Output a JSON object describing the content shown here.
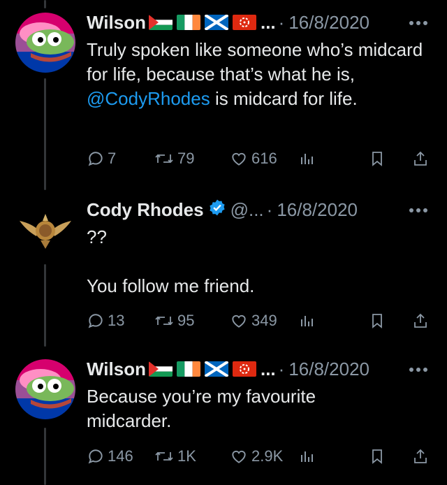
{
  "tweets": [
    {
      "name": "Wilson",
      "flags": [
        "palestine-flag",
        "ireland-flag",
        "scotland-flag",
        "hong-kong-flag"
      ],
      "ellipsis": "...",
      "date": "16/8/2020",
      "text_pre": "Truly spoken like someone who’s midcard for life, because that’s what he is, ",
      "mention": "@CodyRhodes",
      "text_post": " is midcard for life.",
      "replies": "7",
      "reposts": "79",
      "likes": "616"
    },
    {
      "name": "Cody Rhodes",
      "verified": true,
      "handle": "@...",
      "date": "16/8/2020",
      "line1": "??",
      "line2": "You follow me friend.",
      "replies": "13",
      "reposts": "95",
      "likes": "349"
    },
    {
      "name": "Wilson",
      "flags": [
        "palestine-flag",
        "ireland-flag",
        "scotland-flag",
        "hong-kong-flag"
      ],
      "ellipsis": "...",
      "date": "16/8/2020",
      "text": "Because you’re my favourite midcarder.",
      "replies": "146",
      "reposts": "1K",
      "likes": "2.9K"
    }
  ],
  "ui": {
    "dot_separator": "·",
    "accent": "#1d9bf0",
    "secondary": "#8b98a5"
  }
}
